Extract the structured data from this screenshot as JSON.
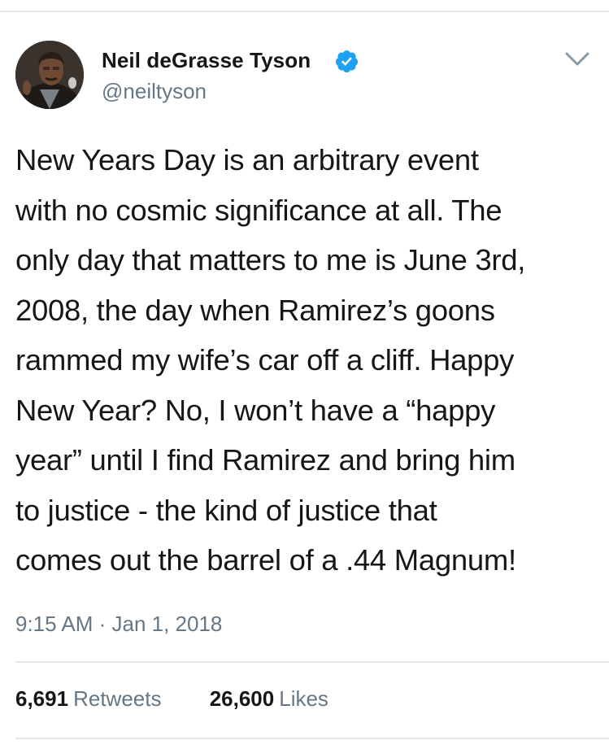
{
  "author": {
    "display_name": "Neil deGrasse Tyson",
    "handle": "@neiltyson",
    "verified": true
  },
  "icons": {
    "verified": "verified-badge-icon",
    "menu": "chevron-down-icon"
  },
  "colors": {
    "verified_blue": "#1da1f2",
    "secondary_text": "#657786",
    "primary_text": "#14171a",
    "divider": "#e1e8ed"
  },
  "tweet": {
    "lines": [
      "New Years Day is an arbitrary event",
      "with no cosmic significance at all. The",
      "only day that matters to me is June 3rd,",
      "2008, the day when Ramirez’s goons",
      "rammed my wife’s car off a cliff. Happy",
      "New Year? No, I won’t have a “happy",
      "year” until I find Ramirez and bring him",
      "to justice - the kind of justice that",
      "comes out the barrel of a .44 Magnum!"
    ],
    "timestamp": "9:15 AM · Jan 1, 2018"
  },
  "stats": {
    "retweets_count": "6,691",
    "retweets_label": "Retweets",
    "likes_count": "26,600",
    "likes_label": "Likes"
  }
}
